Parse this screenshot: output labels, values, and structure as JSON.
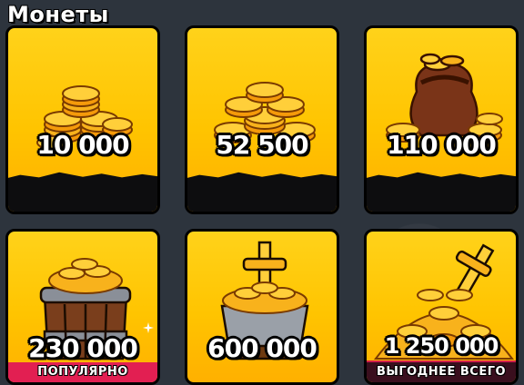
{
  "section": {
    "title": "Монеты"
  },
  "offers": [
    {
      "amount": "10 000",
      "badge": ""
    },
    {
      "amount": "52 500",
      "badge": ""
    },
    {
      "amount": "110 000",
      "badge": ""
    },
    {
      "amount": "230 000",
      "badge": "ПОПУЛЯРНО"
    },
    {
      "amount": "600 000",
      "badge": ""
    },
    {
      "amount": "1 250 000",
      "badge": "ВЫГОДНЕЕ ВСЕГО"
    }
  ],
  "colors": {
    "card": "#ffc400",
    "badge_popular": "#e21f52",
    "badge_best": "#3a0f1e"
  },
  "icons": [
    "coin-stack-icon",
    "coin-pile-icon",
    "coin-sack-icon",
    "coin-barrel-icon",
    "coin-cauldron-icon",
    "coin-treasure-icon"
  ]
}
